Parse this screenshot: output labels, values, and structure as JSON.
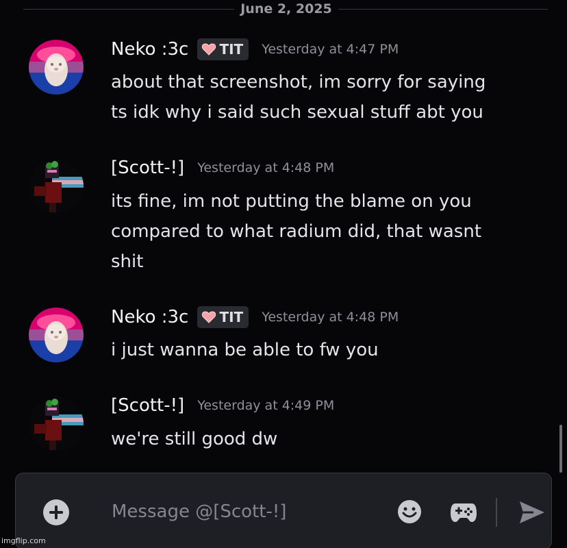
{
  "date_divider": "June 2, 2025",
  "messages": [
    {
      "author": "Neko :3c",
      "avatar": "bisexual-flag-cat-avatar",
      "tag": "TIT",
      "tag_icon": "heart-icon",
      "timestamp": "Yesterday at 4:47 PM",
      "lines": [
        "about that screenshot, im sorry for saying",
        "ts idk why i said such sexual stuff abt you"
      ]
    },
    {
      "author": "[Scott-!]",
      "avatar": "roblox-character-avatar",
      "timestamp": "Yesterday at 4:48 PM",
      "lines": [
        "its fine, im not putting the blame on you",
        "compared to what radium did, that wasnt",
        "shit"
      ]
    },
    {
      "author": "Neko :3c",
      "avatar": "bisexual-flag-cat-avatar",
      "tag": "TIT",
      "tag_icon": "heart-icon",
      "timestamp": "Yesterday at 4:48 PM",
      "lines": [
        "i just wanna be able to fw you"
      ]
    },
    {
      "author": "[Scott-!]",
      "avatar": "roblox-character-avatar",
      "timestamp": "Yesterday at 4:49 PM",
      "lines": [
        "we're still good dw"
      ]
    }
  ],
  "composer": {
    "placeholder": "Message @[Scott-!]",
    "value": "",
    "icons": [
      "plus-circle-icon",
      "emoji-icon",
      "gamepad-icon",
      "send-icon"
    ]
  },
  "watermark": "imgflip.com",
  "colors": {
    "background": "#060608",
    "composer": "#1e1f24",
    "username": "#f2f3f5",
    "timestamp": "#8f909a",
    "tag_background": "#2a2b31"
  }
}
